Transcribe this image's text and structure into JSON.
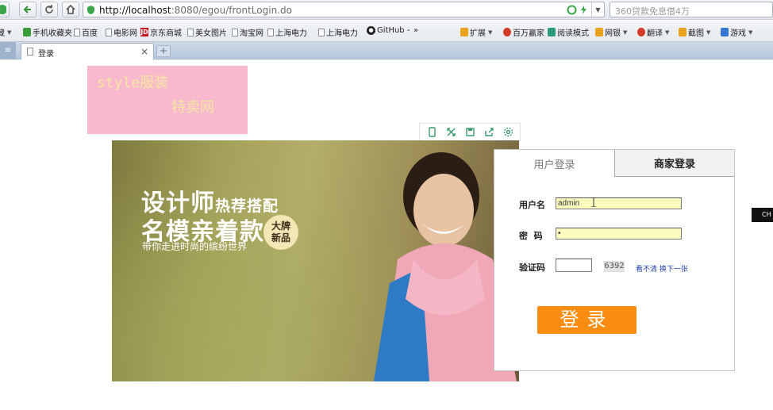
{
  "browser": {
    "url_host": "http://localhost",
    "url_path": ":8080/egou/frontLogin.do",
    "search_placeholder": "360贷款免息借4万",
    "bookmarks": [
      "藏",
      "手机收藏夹",
      "百度",
      "电影网",
      "京东商城",
      "美女图片",
      "淘宝网",
      "上海电力",
      "上海电力",
      "GitHub -",
      "»",
      "扩展",
      "百万赢家",
      "阅读模式",
      "网银",
      "翻译",
      "截图",
      "游戏"
    ],
    "tab_title": "登录",
    "tab_close": "×",
    "tab_new": "+"
  },
  "logo": {
    "line1": "style服装",
    "line2": "特卖网"
  },
  "banner": {
    "headline1_main": "设计师",
    "headline1_small": "热荐搭配",
    "headline2": "名模亲着款",
    "subline": "带你走进时尚的缤纷世界",
    "badge_line1": "大牌",
    "badge_line2": "新品"
  },
  "login": {
    "tab_user": "用户登录",
    "tab_merchant": "商家登录",
    "username_label": "用户名",
    "username_value": "admin",
    "password_label": "密  码",
    "password_value": "•",
    "captcha_label": "验证码",
    "captcha_value": "",
    "captcha_code": "6392",
    "refresh_link": "看不清 换下一张",
    "submit_label": "登录"
  },
  "side_widget": "CH"
}
